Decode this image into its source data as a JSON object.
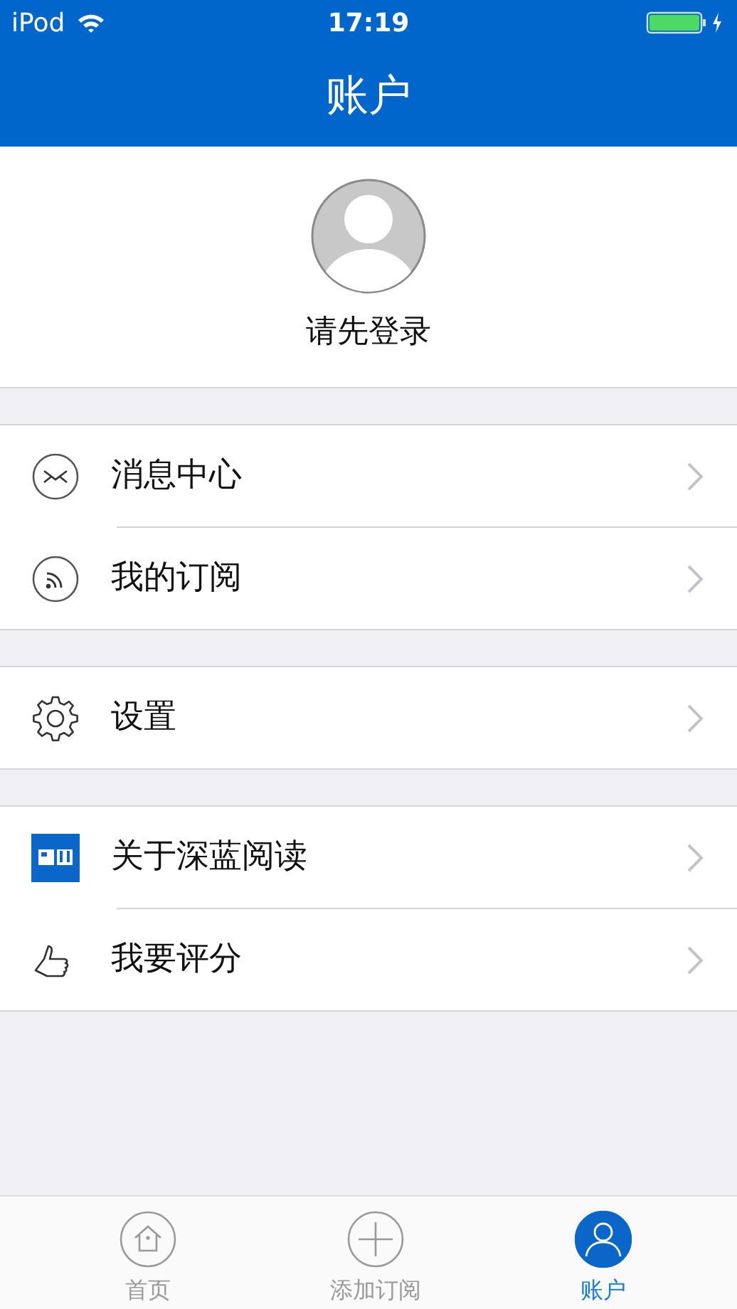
{
  "status_bar": {
    "carrier": "iPod",
    "time": "17:19"
  },
  "nav_bar": {
    "title": "账户"
  },
  "profile": {
    "login_prompt": "请先登录"
  },
  "menu_groups": [
    {
      "items": [
        {
          "kind": "mail",
          "label": "消息中心"
        },
        {
          "kind": "rss",
          "label": "我的订阅"
        }
      ]
    },
    {
      "items": [
        {
          "kind": "gear",
          "label": "设置"
        }
      ]
    },
    {
      "items": [
        {
          "kind": "app",
          "label": "关于深蓝阅读"
        },
        {
          "kind": "thumb",
          "label": "我要评分"
        }
      ]
    }
  ],
  "tab_bar": [
    {
      "kind": "home",
      "label": "首页",
      "selected": false
    },
    {
      "kind": "add",
      "label": "添加订阅",
      "selected": false
    },
    {
      "kind": "user",
      "label": "账户",
      "selected": true
    }
  ]
}
